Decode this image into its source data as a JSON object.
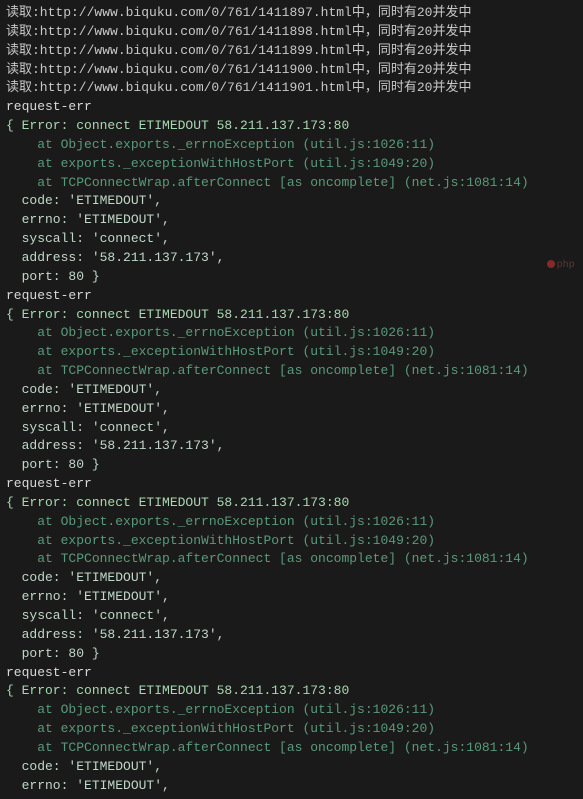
{
  "fetchLines": [
    "读取:http://www.biquku.com/0/761/1411897.html中，同时有20并发中",
    "读取:http://www.biquku.com/0/761/1411898.html中，同时有20并发中",
    "读取:http://www.biquku.com/0/761/1411899.html中，同时有20并发中",
    "读取:http://www.biquku.com/0/761/1411900.html中，同时有20并发中",
    "读取:http://www.biquku.com/0/761/1411901.html中，同时有20并发中"
  ],
  "errorBlocks": [
    {
      "label": "request-err",
      "header": "{ Error: connect ETIMEDOUT 58.211.137.173:80",
      "stack": [
        "    at Object.exports._errnoException (util.js:1026:11)",
        "    at exports._exceptionWithHostPort (util.js:1049:20)",
        "    at TCPConnectWrap.afterConnect [as oncomplete] (net.js:1081:14)"
      ],
      "props": [
        "  code: 'ETIMEDOUT',",
        "  errno: 'ETIMEDOUT',",
        "  syscall: 'connect',",
        "  address: '58.211.137.173',",
        "  port: 80 }"
      ]
    },
    {
      "label": "request-err",
      "header": "{ Error: connect ETIMEDOUT 58.211.137.173:80",
      "stack": [
        "    at Object.exports._errnoException (util.js:1026:11)",
        "    at exports._exceptionWithHostPort (util.js:1049:20)",
        "    at TCPConnectWrap.afterConnect [as oncomplete] (net.js:1081:14)"
      ],
      "props": [
        "  code: 'ETIMEDOUT',",
        "  errno: 'ETIMEDOUT',",
        "  syscall: 'connect',",
        "  address: '58.211.137.173',",
        "  port: 80 }"
      ]
    },
    {
      "label": "request-err",
      "header": "{ Error: connect ETIMEDOUT 58.211.137.173:80",
      "stack": [
        "    at Object.exports._errnoException (util.js:1026:11)",
        "    at exports._exceptionWithHostPort (util.js:1049:20)",
        "    at TCPConnectWrap.afterConnect [as oncomplete] (net.js:1081:14)"
      ],
      "props": [
        "  code: 'ETIMEDOUT',",
        "  errno: 'ETIMEDOUT',",
        "  syscall: 'connect',",
        "  address: '58.211.137.173',",
        "  port: 80 }"
      ]
    },
    {
      "label": "request-err",
      "header": "{ Error: connect ETIMEDOUT 58.211.137.173:80",
      "stack": [
        "    at Object.exports._errnoException (util.js:1026:11)",
        "    at exports._exceptionWithHostPort (util.js:1049:20)",
        "    at TCPConnectWrap.afterConnect [as oncomplete] (net.js:1081:14)"
      ],
      "props": [
        "  code: 'ETIMEDOUT',",
        "  errno: 'ETIMEDOUT',"
      ]
    }
  ],
  "watermark": "php"
}
